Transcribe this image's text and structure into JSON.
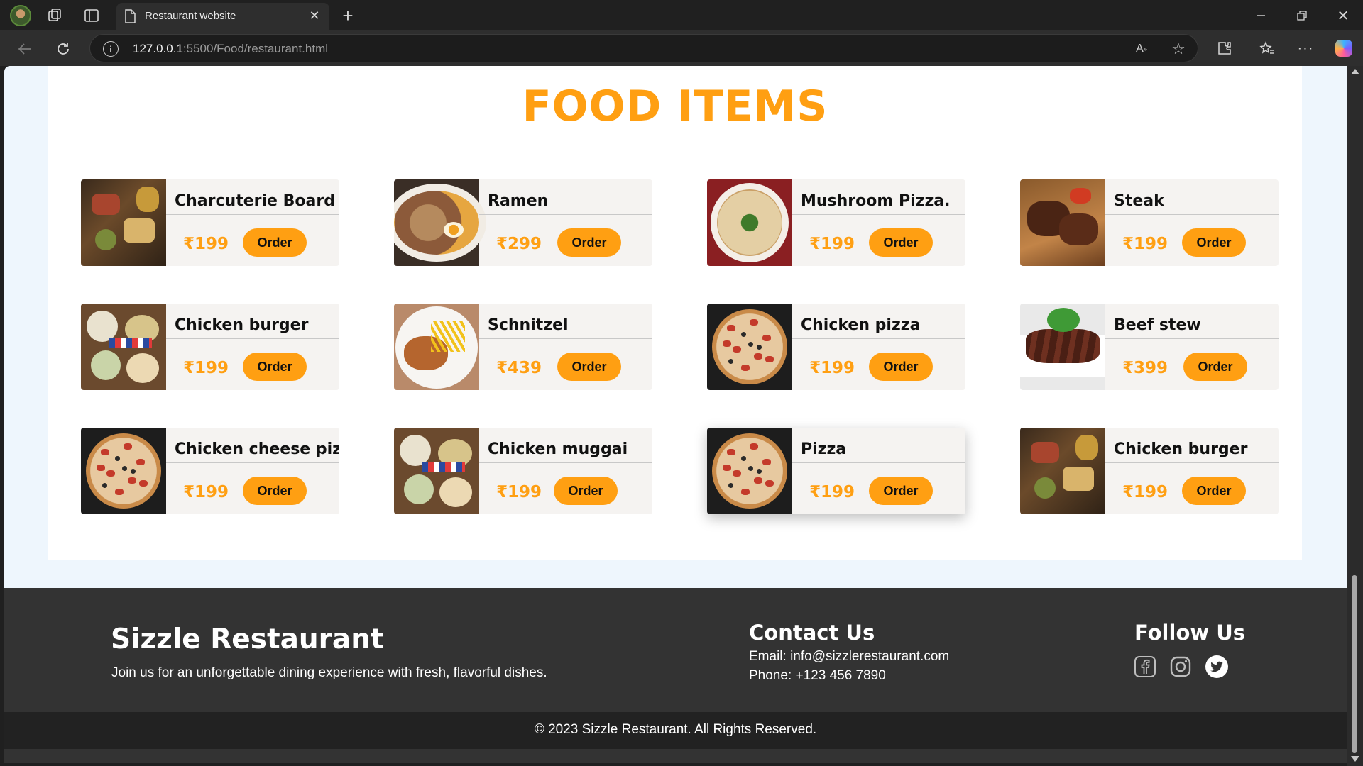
{
  "browser": {
    "tab_title": "Restaurant website",
    "url_host": "127.0.0.1",
    "url_rest": ":5500/Food/restaurant.html"
  },
  "menu": {
    "title": "FOOD ITEMS",
    "order_label": "Order",
    "items": [
      {
        "name": "Charcuterie Board",
        "price": "₹199",
        "image": "charcuterie"
      },
      {
        "name": "Ramen",
        "price": "₹299",
        "image": "ramen"
      },
      {
        "name": "Mushroom Pizza.",
        "price": "₹199",
        "image": "mushroom-pizza"
      },
      {
        "name": "Steak",
        "price": "₹199",
        "image": "steak"
      },
      {
        "name": "Chicken burger",
        "price": "₹199",
        "image": "table-spread"
      },
      {
        "name": "Schnitzel",
        "price": "₹439",
        "image": "schnitzel"
      },
      {
        "name": "Chicken pizza",
        "price": "₹199",
        "image": "pizza"
      },
      {
        "name": "Beef stew",
        "price": "₹399",
        "image": "beef-stew"
      },
      {
        "name": "Chicken cheese pizza",
        "price": "₹199",
        "image": "pizza"
      },
      {
        "name": "Chicken muggai",
        "price": "₹199",
        "image": "table-spread"
      },
      {
        "name": "Pizza",
        "price": "₹199",
        "image": "pizza"
      },
      {
        "name": "Chicken burger",
        "price": "₹199",
        "image": "charcuterie"
      }
    ]
  },
  "footer": {
    "brand": "Sizzle Restaurant",
    "tagline": "Join us for an unforgettable dining experience with fresh, flavorful dishes.",
    "contact_title": "Contact Us",
    "email": "Email: info@sizzlerestaurant.com",
    "phone": "Phone: +123 456 7890",
    "follow_title": "Follow Us",
    "socials": [
      "facebook-icon",
      "instagram-icon",
      "twitter-icon"
    ],
    "copyright": "© 2023 Sizzle Restaurant. All Rights Reserved."
  },
  "colors": {
    "accent": "#ff9f12",
    "footer_bg": "#333333",
    "copyright_bg": "#222222",
    "page_bg": "#eef6fd"
  }
}
